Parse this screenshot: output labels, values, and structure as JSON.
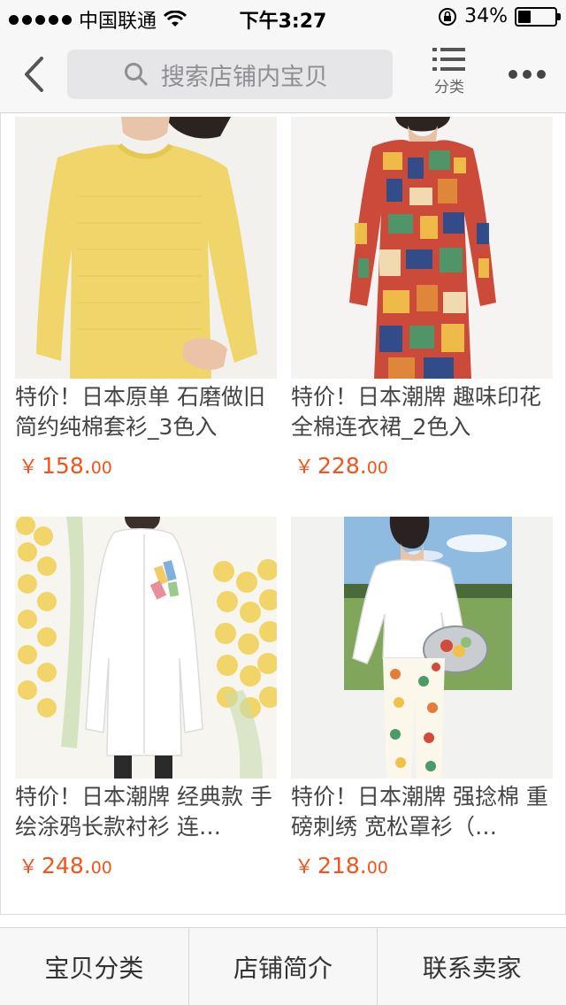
{
  "status_bar": {
    "carrier": "中国联通",
    "time": "下午3:27",
    "battery_text": "34%",
    "battery_level": 0.34
  },
  "nav": {
    "search_placeholder": "搜索店铺内宝贝",
    "category_label": "分类"
  },
  "products": [
    {
      "title": "特价！日本原单 石磨做旧 简约纯棉套衫_3色入",
      "currency": "￥",
      "price_int": "158.",
      "price_dec": "00",
      "image_icon": "yellow-knit-sweater"
    },
    {
      "title": "特价！日本潮牌 趣味印花 全棉连衣裙_2色入",
      "currency": "￥",
      "price_int": "228.",
      "price_dec": "00",
      "image_icon": "printed-dress"
    },
    {
      "title": "特价！日本潮牌 经典款 手绘涂鸦长款衬衫 连…",
      "currency": "￥",
      "price_int": "248.",
      "price_dec": "00",
      "image_icon": "white-long-shirt"
    },
    {
      "title": "特价！日本潮牌 强捻棉 重磅刺绣 宽松罩衫（…",
      "currency": "￥",
      "price_int": "218.",
      "price_dec": "00",
      "image_icon": "white-smock-fruit-pants"
    }
  ],
  "tabs": [
    {
      "label": "宝贝分类"
    },
    {
      "label": "店铺简介"
    },
    {
      "label": "联系卖家"
    }
  ],
  "colors": {
    "price": "#f2541c",
    "nav_background": "#f7f7f7",
    "search_background": "#e6e6e8"
  }
}
